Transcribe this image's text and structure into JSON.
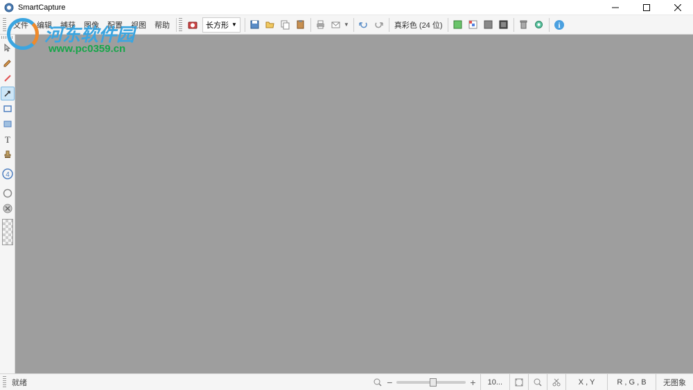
{
  "window": {
    "title": "SmartCapture"
  },
  "menus": {
    "file": "文件",
    "edit": "编辑",
    "capture": "捕获",
    "image": "图像",
    "config": "配置",
    "view": "视图",
    "help": "帮助"
  },
  "toolbar": {
    "capture_mode": "长方形",
    "color_depth": "真彩色 (24 位)"
  },
  "statusbar": {
    "status": "就绪",
    "zoom": "10...",
    "coords": "X , Y",
    "color": "R , G , B",
    "image_info": "无图象"
  },
  "watermark": {
    "line1": "河东软件园",
    "line2": "www.pc0359.cn"
  }
}
